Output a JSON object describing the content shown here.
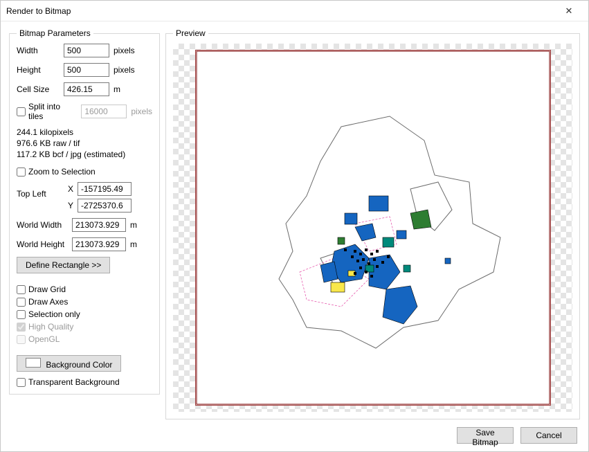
{
  "window": {
    "title": "Render to Bitmap"
  },
  "params": {
    "legend": "Bitmap Parameters",
    "width_label": "Width",
    "width_value": "500",
    "width_unit": "pixels",
    "height_label": "Height",
    "height_value": "500",
    "height_unit": "pixels",
    "cellsize_label": "Cell Size",
    "cellsize_value": "426.15",
    "cellsize_unit": "m",
    "split_label": "Split into tiles",
    "split_value": "16000",
    "split_unit": "pixels",
    "info_line1": "244.1 kilopixels",
    "info_line2": "976.6 KB raw / tif",
    "info_line3": "117.2 KB bcf / jpg (estimated)",
    "zoom_label": "Zoom to Selection",
    "topleft_label": "Top Left",
    "x_label": "X",
    "x_value": "-157195.49",
    "y_label": "Y",
    "y_value": "-2725370.6",
    "worldw_label": "World Width",
    "worldw_value": "213073.929",
    "worldw_unit": "m",
    "worldh_label": "World Height",
    "worldh_value": "213073.929",
    "worldh_unit": "m",
    "definerect_label": "Define Rectangle >>",
    "drawgrid_label": "Draw Grid",
    "drawaxes_label": "Draw Axes",
    "selonly_label": "Selection only",
    "highq_label": "High Quality",
    "opengl_label": "OpenGL",
    "bgcolor_label": "Background Color",
    "transparent_label": "Transparent Background"
  },
  "preview": {
    "legend": "Preview"
  },
  "footer": {
    "save_label": "Save Bitmap",
    "cancel_label": "Cancel"
  },
  "colors": {
    "poly_blue": "#1565c0",
    "poly_teal": "#00897b",
    "poly_green": "#2e7d32",
    "poly_yellow": "#f9e74b",
    "outline_grey": "#6b6b6b",
    "outline_pink": "#e75fb0",
    "frame_red": "#7a0000"
  }
}
